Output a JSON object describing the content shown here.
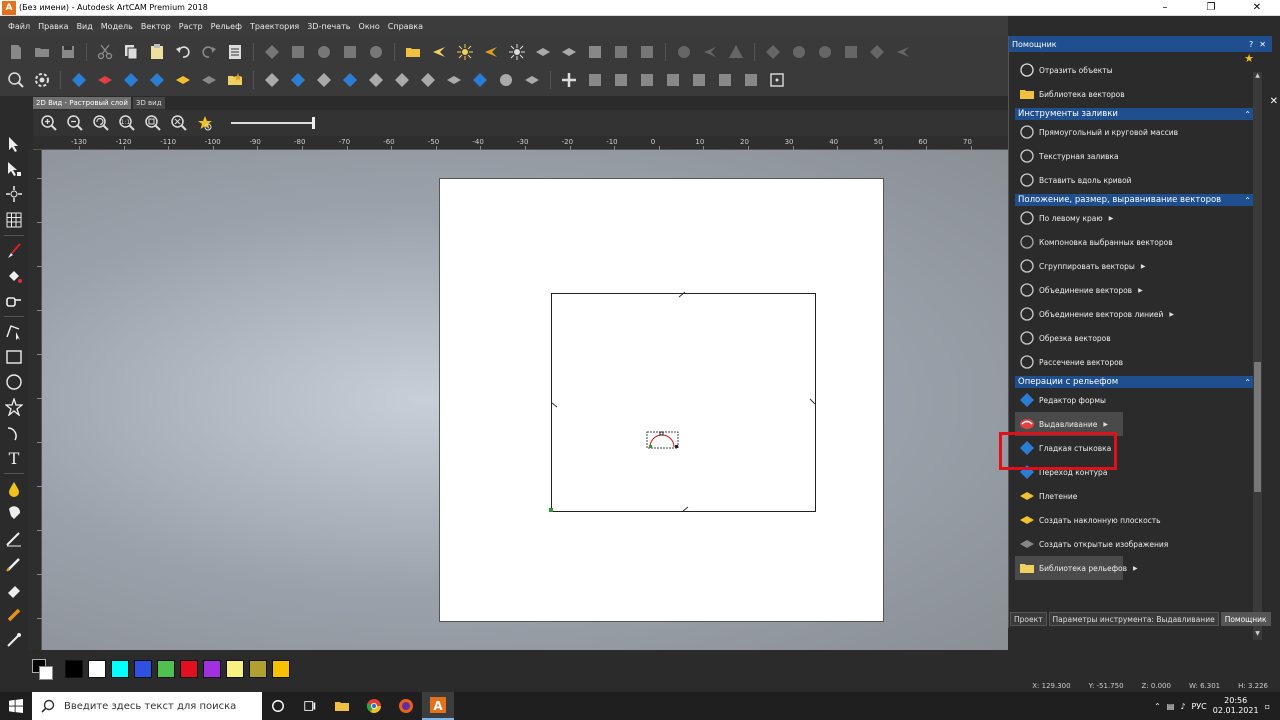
{
  "window": {
    "title": "(Без имени) - Autodesk ArtCAM Premium 2018"
  },
  "menu": [
    "Файл",
    "Правка",
    "Вид",
    "Модель",
    "Вектор",
    "Растр",
    "Рельеф",
    "Траектория",
    "3D-печать",
    "Окно",
    "Справка"
  ],
  "view_tabs": [
    "2D Вид - Растровый слой",
    "3D вид"
  ],
  "ruler": {
    "h_labels": [
      "-130",
      "-120",
      "-110",
      "-100",
      "-90",
      "-80",
      "-70",
      "-60",
      "-50",
      "-40",
      "-30",
      "-20",
      "-10",
      "0",
      "10",
      "20",
      "30",
      "40",
      "50",
      "60",
      "70",
      "80"
    ]
  },
  "palette": [
    "#000000",
    "#ffffff",
    "#00ffff",
    "#3050e0",
    "#50c050",
    "#e01020",
    "#a030e0",
    "#f8f080",
    "#b0a030",
    "#f8c000"
  ],
  "status": {
    "x": "X: 129.300",
    "y": "Y: -51.750",
    "z": "Z: 0.000",
    "w": "W: 6.301",
    "h": "H: 3.226"
  },
  "taskbar": {
    "search_placeholder": "Введите здесь текст для поиска",
    "lang": "РУС",
    "time": "20:56",
    "date": "02.01.2021"
  },
  "panel": {
    "title": "Помощник",
    "top_items": [
      {
        "label": "Отразить объекты",
        "icon": "mirror-icon"
      },
      {
        "label": "Библиотека векторов",
        "icon": "folder-vector-icon"
      }
    ],
    "sections": [
      {
        "title": "Инструменты заливки",
        "items": [
          {
            "label": "Прямоугольный и круговой массив",
            "icon": "array-icon",
            "arrow": false
          },
          {
            "label": "Текстурная заливка",
            "icon": "texture-fill-icon",
            "arrow": false
          },
          {
            "label": "Вставить вдоль кривой",
            "icon": "along-curve-icon",
            "arrow": false
          }
        ]
      },
      {
        "title": "Положение, размер, выравнивание векторов",
        "items": [
          {
            "label": "По левому краю",
            "icon": "align-left-icon",
            "arrow": true
          },
          {
            "label": "Компоновка выбранных векторов",
            "icon": "nesting-icon",
            "arrow": false
          },
          {
            "label": "Сгруппировать векторы",
            "icon": "group-icon",
            "arrow": true
          },
          {
            "label": "Объединение векторов",
            "icon": "weld-icon",
            "arrow": true
          },
          {
            "label": "Объединение векторов линией",
            "icon": "join-line-icon",
            "arrow": true
          },
          {
            "label": "Обрезка векторов",
            "icon": "trim-icon",
            "arrow": false
          },
          {
            "label": "Рассечение векторов",
            "icon": "split-icon",
            "arrow": false
          }
        ]
      },
      {
        "title": "Операции с рельефом",
        "items": [
          {
            "label": "Редактор формы",
            "icon": "shape-editor-icon",
            "arrow": false
          },
          {
            "label": "Выдавливание",
            "icon": "extrude-icon",
            "arrow": true
          },
          {
            "label": "Гладкая стыковка",
            "icon": "smooth-join-icon",
            "arrow": false
          },
          {
            "label": "Переход контура",
            "icon": "contour-transition-icon",
            "arrow": false
          },
          {
            "label": "Плетение",
            "icon": "weave-icon",
            "arrow": false
          },
          {
            "label": "Создать наклонную плоскость",
            "icon": "slope-plane-icon",
            "arrow": false
          },
          {
            "label": "Создать открытые изображения",
            "icon": "open-image-icon",
            "arrow": false
          },
          {
            "label": "Библиотека рельефов",
            "icon": "relief-library-icon",
            "arrow": true
          }
        ]
      }
    ],
    "tabs": [
      "Проект",
      "Параметры инструмента: Выдавливание",
      "Помощник"
    ],
    "active_tab": 2
  }
}
